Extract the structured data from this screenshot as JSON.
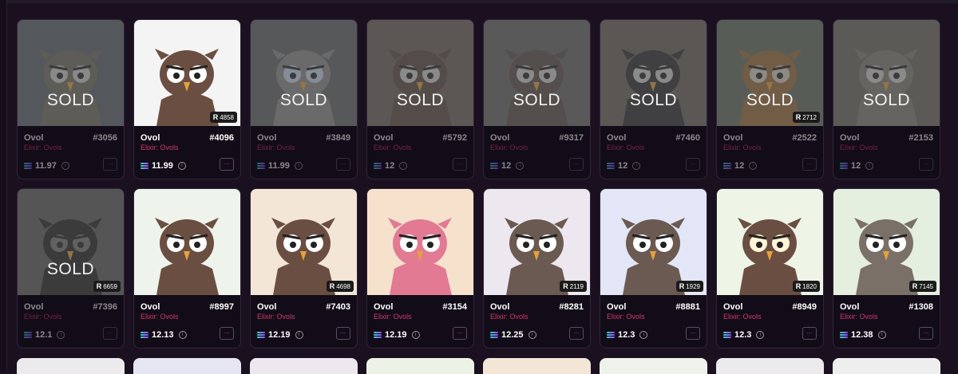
{
  "cards": [
    {
      "name": "Ovol",
      "number": "#3056",
      "collection": "Elixir: Ovols",
      "price": "11.97",
      "sold": true,
      "sold_label": "SOLD",
      "rank": "",
      "bg": "#5a6068",
      "body": "#6e6a60",
      "eye": "#cfcfcf"
    },
    {
      "name": "Ovol",
      "number": "#4096",
      "collection": "Elixir: Ovols",
      "price": "11.99",
      "sold": false,
      "sold_label": "",
      "rank": "4858",
      "bg": "#f4f4f4",
      "body": "#6b4e42",
      "eye": "#ffffff"
    },
    {
      "name": "Ovol",
      "number": "#3849",
      "collection": "Elixir: Ovols",
      "price": "11.99",
      "sold": true,
      "sold_label": "SOLD",
      "rank": "",
      "bg": "#606264",
      "body": "#8a8a8a",
      "eye": "#c8d8f0"
    },
    {
      "name": "Ovol",
      "number": "#5792",
      "collection": "Elixir: Ovols",
      "price": "12",
      "sold": true,
      "sold_label": "SOLD",
      "rank": "",
      "bg": "#6b5f5c",
      "body": "#5a4840",
      "eye": "#d0d0d0"
    },
    {
      "name": "Ovol",
      "number": "#9317",
      "collection": "Elixir: Ovols",
      "price": "12",
      "sold": true,
      "sold_label": "SOLD",
      "rank": "",
      "bg": "#636563",
      "body": "#5a4c48",
      "eye": "#d0d0d0"
    },
    {
      "name": "Ovol",
      "number": "#7460",
      "collection": "Elixir: Ovols",
      "price": "12",
      "sold": true,
      "sold_label": "SOLD",
      "rank": "",
      "bg": "#66615c",
      "body": "#2e2e33",
      "eye": "#d0d0d0"
    },
    {
      "name": "Ovol",
      "number": "#2522",
      "collection": "Elixir: Ovols",
      "price": "12",
      "sold": true,
      "sold_label": "SOLD",
      "rank": "2712",
      "bg": "#626a60",
      "body": "#9a6a3a",
      "eye": "#d8d0c0"
    },
    {
      "name": "Ovol",
      "number": "#2153",
      "collection": "Elixir: Ovols",
      "price": "12",
      "sold": true,
      "sold_label": "SOLD",
      "rank": "",
      "bg": "#68665e",
      "body": "#807c74",
      "eye": "#d0d0d0"
    },
    {
      "name": "Ovol",
      "number": "#7396",
      "collection": "Elixir: Ovols",
      "price": "12.1",
      "sold": true,
      "sold_label": "SOLD",
      "rank": "6659",
      "bg": "#5c5c5c",
      "body": "#222222",
      "eye": "#777777"
    },
    {
      "name": "Ovol",
      "number": "#8997",
      "collection": "Elixir: Ovols",
      "price": "12.13",
      "sold": false,
      "sold_label": "",
      "rank": "",
      "bg": "#eef3ec",
      "body": "#6b4e42",
      "eye": "#ffffff"
    },
    {
      "name": "Ovol",
      "number": "#7403",
      "collection": "Elixir: Ovols",
      "price": "12.19",
      "sold": false,
      "sold_label": "",
      "rank": "4698",
      "bg": "#f3e6d6",
      "body": "#6b4e42",
      "eye": "#ffffff"
    },
    {
      "name": "Ovol",
      "number": "#3154",
      "collection": "Elixir: Ovols",
      "price": "12.19",
      "sold": false,
      "sold_label": "",
      "rank": "",
      "bg": "#f6e2cc",
      "body": "#e27a94",
      "eye": "#ffffff"
    },
    {
      "name": "Ovol",
      "number": "#8281",
      "collection": "Elixir: Ovols",
      "price": "12.25",
      "sold": false,
      "sold_label": "",
      "rank": "2119",
      "bg": "#ede8ef",
      "body": "#6b5a52",
      "eye": "#ffffff"
    },
    {
      "name": "Ovol",
      "number": "#8881",
      "collection": "Elixir: Ovols",
      "price": "12.3",
      "sold": false,
      "sold_label": "",
      "rank": "1929",
      "bg": "#e3e6f6",
      "body": "#6b5a52",
      "eye": "#ffffff"
    },
    {
      "name": "Ovol",
      "number": "#8949",
      "collection": "Elixir: Ovols",
      "price": "12.3",
      "sold": false,
      "sold_label": "",
      "rank": "1820",
      "bg": "#eef5e6",
      "body": "#6b4e42",
      "eye": "#fff4d6"
    },
    {
      "name": "Ovol",
      "number": "#1308",
      "collection": "Elixir: Ovols",
      "price": "12.38",
      "sold": false,
      "sold_label": "",
      "rank": "7145",
      "bg": "#e4efe0",
      "body": "#7a7068",
      "eye": "#ffffff"
    }
  ],
  "bottom_row_bgs": [
    "#eceaec",
    "#e6e6f2",
    "#ece8ee",
    "#ecf3e6",
    "#f3e6d6",
    "#eef2ea",
    "#eceaec",
    "#eeeeee",
    "#f3e2e2"
  ],
  "icons": {
    "currency": "sol-icon",
    "info": "info-icon",
    "more": "more-icon",
    "rank": "rank-icon"
  },
  "labels": {
    "more": "...",
    "info": "i",
    "rank_prefix": "R"
  }
}
